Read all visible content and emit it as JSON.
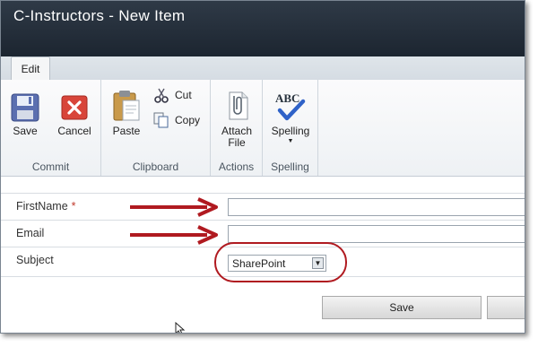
{
  "window": {
    "title": "C-Instructors - New Item"
  },
  "ribbon": {
    "tab": "Edit",
    "groups": {
      "commit": {
        "label": "Commit",
        "save": "Save",
        "cancel": "Cancel"
      },
      "clipboard": {
        "label": "Clipboard",
        "paste": "Paste",
        "cut": "Cut",
        "copy": "Copy"
      },
      "actions": {
        "label": "Actions",
        "attach_line1": "Attach",
        "attach_line2": "File"
      },
      "spelling": {
        "label": "Spelling",
        "spelling": "Spelling",
        "icon_text": "ABC"
      }
    }
  },
  "form": {
    "fields": [
      {
        "label": "FirstName",
        "required_marker": "*",
        "value": ""
      },
      {
        "label": "Email",
        "value": ""
      },
      {
        "label": "Subject",
        "selected": "SharePoint"
      }
    ]
  },
  "footer": {
    "save": "Save"
  },
  "colors": {
    "titlebar": "#1f2833",
    "annotation": "#b01a20",
    "required": "#c0392b"
  }
}
